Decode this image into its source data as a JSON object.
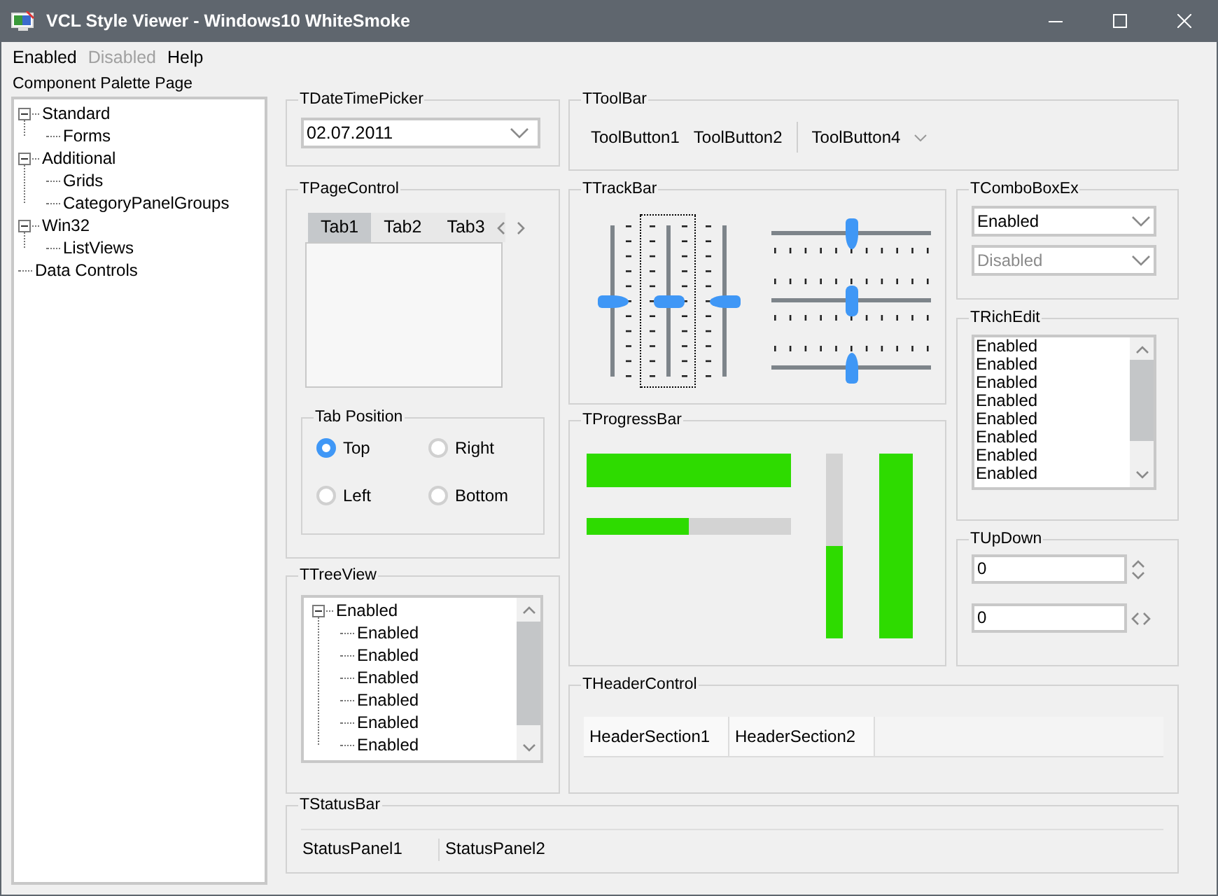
{
  "window": {
    "title": "VCL Style Viewer - Windows10 WhiteSmoke"
  },
  "menu": [
    {
      "label": "Enabled",
      "disabled": false
    },
    {
      "label": "Disabled",
      "disabled": true
    },
    {
      "label": "Help",
      "disabled": false
    }
  ],
  "sidebar": {
    "title": "Component Palette Page",
    "items": [
      {
        "label": "Standard",
        "expanded": true,
        "children": [
          {
            "label": "Forms"
          }
        ]
      },
      {
        "label": "Additional",
        "expanded": true,
        "children": [
          {
            "label": "Grids"
          },
          {
            "label": "CategoryPanelGroups"
          }
        ]
      },
      {
        "label": "Win32",
        "expanded": true,
        "children": [
          {
            "label": "ListViews"
          }
        ]
      },
      {
        "label": "Data Controls"
      }
    ]
  },
  "date_time_picker": {
    "title": "TDateTimePicker",
    "value": "02.07.2011"
  },
  "toolbar": {
    "title": "TToolBar",
    "buttons": [
      {
        "kind": "button",
        "label": "ToolButton1"
      },
      {
        "kind": "button",
        "label": "ToolButton2"
      },
      {
        "kind": "separator"
      },
      {
        "kind": "dropdown",
        "label": "ToolButton4"
      }
    ]
  },
  "page_control": {
    "title": "TPageControl",
    "tabs": [
      {
        "label": "Tab1",
        "selected": true
      },
      {
        "label": "Tab2",
        "selected": false
      },
      {
        "label": "Tab3",
        "selected": false
      }
    ],
    "tab_position": {
      "title": "Tab Position",
      "options": [
        {
          "label": "Top",
          "selected": true
        },
        {
          "label": "Right",
          "selected": false
        },
        {
          "label": "Left",
          "selected": false
        },
        {
          "label": "Bottom",
          "selected": false
        }
      ]
    }
  },
  "tree_view": {
    "title": "TTreeView",
    "items": [
      {
        "label": "Enabled",
        "expanded": true,
        "children": [
          {
            "label": "Enabled"
          },
          {
            "label": "Enabled"
          },
          {
            "label": "Enabled"
          },
          {
            "label": "Enabled"
          },
          {
            "label": "Enabled"
          },
          {
            "label": "Enabled"
          }
        ]
      }
    ]
  },
  "track_bar": {
    "title": "TTrackBar",
    "sliders": [
      {
        "kind": "vertical",
        "ticks_before": false,
        "ticks_after": true,
        "level": 0.5,
        "focused": false
      },
      {
        "kind": "vertical",
        "ticks_before": true,
        "ticks_after": true,
        "level": 0.5,
        "focused": true
      },
      {
        "kind": "vertical",
        "ticks_before": true,
        "ticks_after": false,
        "level": 0.5,
        "focused": false
      },
      {
        "kind": "horizontal",
        "ticks_before": false,
        "ticks_after": true,
        "level": 0.5,
        "focused": false
      },
      {
        "kind": "horizontal",
        "ticks_before": true,
        "ticks_after": true,
        "level": 0.5,
        "focused": false
      },
      {
        "kind": "horizontal",
        "ticks_before": true,
        "ticks_after": false,
        "level": 0.5,
        "focused": false
      }
    ]
  },
  "progress_bar": {
    "title": "TProgressBar",
    "bars": [
      {
        "kind": "horizontal",
        "level": 1
      },
      {
        "kind": "horizontal",
        "level": 0.5
      },
      {
        "kind": "vertical",
        "level": 0.5
      },
      {
        "kind": "vertical",
        "level": 1
      }
    ]
  },
  "combo_box_ex": {
    "title": "TComboBoxEx",
    "items": [
      {
        "value": "Enabled",
        "disabled": false
      },
      {
        "value": "Disabled",
        "disabled": true
      }
    ]
  },
  "rich_edit": {
    "title": "TRichEdit",
    "lines": [
      "Enabled",
      "Enabled",
      "Enabled",
      "Enabled",
      "Enabled",
      "Enabled",
      "Enabled",
      "Enabled"
    ]
  },
  "up_down": {
    "title": "TUpDown",
    "fields": [
      {
        "value": "0",
        "kind": "vertical"
      },
      {
        "value": "0",
        "kind": "horizontal"
      }
    ]
  },
  "header_control": {
    "title": "THeaderControl",
    "sections": [
      "HeaderSection1",
      "HeaderSection2"
    ]
  },
  "status_bar": {
    "title": "TStatusBar",
    "panels": [
      "StatusPanel1",
      "StatusPanel2"
    ]
  }
}
